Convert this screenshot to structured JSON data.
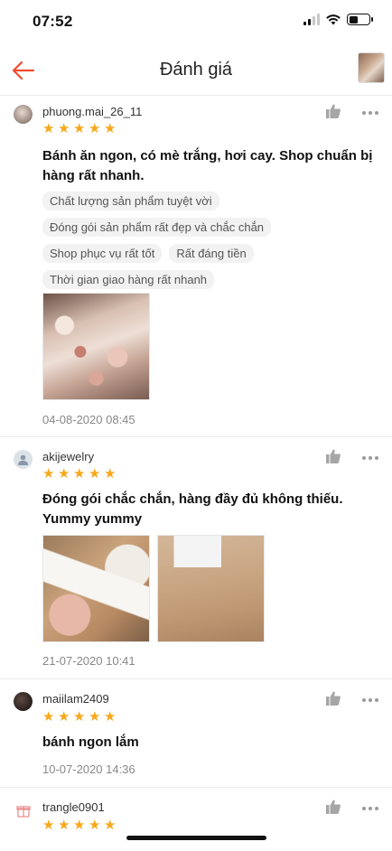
{
  "status_bar": {
    "time": "07:52"
  },
  "header": {
    "title": "Đánh giá"
  },
  "colors": {
    "accent": "#ee4d2d",
    "star": "#f7a81b"
  },
  "reviews": [
    {
      "username": "phuong.mai_26_11",
      "rating": 5,
      "comment": "Bánh ăn ngon, có mè trắng, hơi cay. Shop chuẩn bị hàng rất nhanh.",
      "tags": [
        "Chất lượng sản phẩm tuyệt vời",
        "Đóng gói sản phẩm rất đẹp và chắc chắn",
        "Shop phục vụ rất tốt",
        "Rất đáng tiền",
        "Thời gian giao hàng rất nhanh"
      ],
      "date": "04-08-2020 08:45"
    },
    {
      "username": "akijewelry",
      "rating": 5,
      "comment": "Đóng gói chắc chắn, hàng đầy đủ không thiếu. Yummy yummy",
      "date": "21-07-2020 10:41"
    },
    {
      "username": "maiilam2409",
      "rating": 5,
      "comment": "bánh ngon lắm",
      "date": "10-07-2020 14:36"
    },
    {
      "username": "trangle0901",
      "rating": 5
    }
  ],
  "icons": {
    "back": "arrow-left-icon",
    "like": "thumbs-up-icon",
    "more": "more-horizontal-icon",
    "star": "star-icon"
  }
}
